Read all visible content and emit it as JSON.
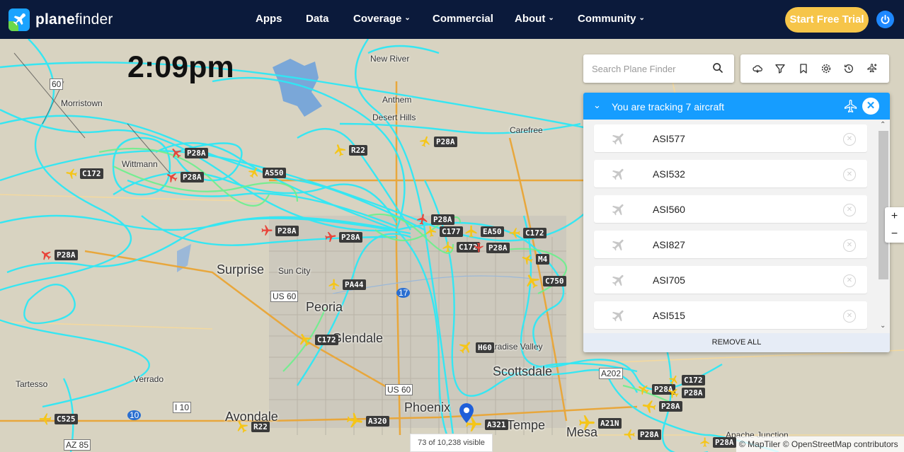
{
  "brand": {
    "name_bold": "plane",
    "name_rest": "finder"
  },
  "nav": {
    "apps": "Apps",
    "data": "Data",
    "coverage": "Coverage",
    "commercial": "Commercial",
    "about": "About",
    "community": "Community",
    "cta": "Start Free Trial"
  },
  "map": {
    "clock": "2:09pm",
    "search_placeholder": "Search Plane Finder",
    "cities": {
      "surprise": "Surprise",
      "sun_city": "Sun City",
      "peoria": "Peoria",
      "glendale": "Glendale",
      "phoenix": "Phoenix",
      "avondale": "Avondale",
      "tempe": "Tempe",
      "mesa": "Mesa",
      "scottsdale": "Scottsdale",
      "paradise_valley": "Paradise Valley",
      "new_river": "New River",
      "anthem": "Anthem",
      "desert_hills": "Desert Hills",
      "carefree": "Carefree",
      "wittmann": "Wittmann",
      "morristown": "Morristown",
      "verrado": "Verrado",
      "tartesso": "Tartesso",
      "apache_junction": "Apache Junction"
    },
    "roads": {
      "us60": "US 60",
      "us60b": "US 60",
      "i10": "I 10",
      "i10b": "10",
      "i17": "17",
      "az85": "AZ 85",
      "az202": "A202",
      "r60": "60"
    },
    "aircraft": [
      {
        "label": "P28A",
        "color": "#e8443a"
      },
      {
        "label": "P28A",
        "color": "#e8443a"
      },
      {
        "label": "C172",
        "color": "#f5c518"
      },
      {
        "label": "AS50",
        "color": "#f5c518"
      },
      {
        "label": "R22",
        "color": "#f5c518"
      },
      {
        "label": "P28A",
        "color": "#f5c518"
      },
      {
        "label": "P28A",
        "color": "#e8443a"
      },
      {
        "label": "P28A",
        "color": "#e8443a"
      },
      {
        "label": "P28A",
        "color": "#e8443a"
      },
      {
        "label": "P28A",
        "color": "#e8443a"
      },
      {
        "label": "C177",
        "color": "#f5c518"
      },
      {
        "label": "EA50",
        "color": "#f5c518"
      },
      {
        "label": "C172",
        "color": "#f5c518"
      },
      {
        "label": "C172",
        "color": "#f5c518"
      },
      {
        "label": "P28A",
        "color": "#e8443a"
      },
      {
        "label": "M4",
        "color": "#f5c518"
      },
      {
        "label": "C750",
        "color": "#f5c518"
      },
      {
        "label": "PA44",
        "color": "#f5c518"
      },
      {
        "label": "C172",
        "color": "#f5c518"
      },
      {
        "label": "H60",
        "color": "#f5c518"
      },
      {
        "label": "C525",
        "color": "#f5c518"
      },
      {
        "label": "R22",
        "color": "#f5c518"
      },
      {
        "label": "A320",
        "color": "#f5c518"
      },
      {
        "label": "A321",
        "color": "#f5c518"
      },
      {
        "label": "A21N",
        "color": "#f5c518"
      },
      {
        "label": "P28A",
        "color": "#f5c518"
      },
      {
        "label": "P28A",
        "color": "#f5c518"
      },
      {
        "label": "P28A",
        "color": "#f5c518"
      },
      {
        "label": "C172",
        "color": "#f5c518"
      },
      {
        "label": "P28A",
        "color": "#f5c518"
      },
      {
        "label": "P28A",
        "color": "#f5c518"
      }
    ],
    "visible_count": "73 of 10,238 visible",
    "attribution": "© MapTiler © OpenStreetMap contributors",
    "zoom_in": "+",
    "zoom_out": "−"
  },
  "tracking": {
    "title": "You are tracking 7 aircraft",
    "remove_all": "REMOVE ALL",
    "items": [
      "ASI577",
      "ASI532",
      "ASI560",
      "ASI827",
      "ASI705",
      "ASI515"
    ]
  },
  "colors": {
    "nav_bg": "#0b1a3b",
    "cta": "#f6c549",
    "accent": "#169dff",
    "track": "#2ee8f5",
    "track_busy": "#6cf08c"
  }
}
